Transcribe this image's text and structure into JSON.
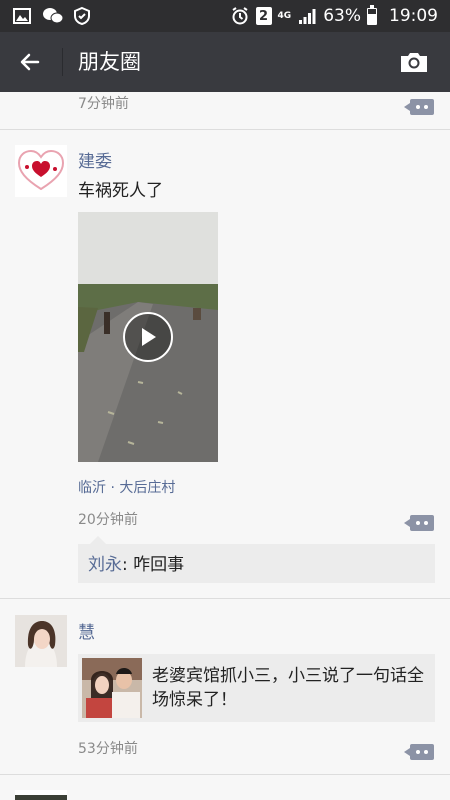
{
  "status_bar": {
    "badge": "2",
    "network": "4G",
    "battery_text": "63%",
    "battery_level": 0.63,
    "time": "19:09",
    "icons": [
      "gallery-icon",
      "wechat-icon",
      "shield-check-icon",
      "alarm-icon",
      "signal-icon",
      "battery-icon"
    ]
  },
  "title_bar": {
    "title": "朋友圈",
    "back_icon": "back-arrow-icon",
    "camera_icon": "camera-icon"
  },
  "feed": {
    "top_partial": {
      "time": "7分钟前"
    },
    "posts": [
      {
        "author": "建委",
        "text": "车祸死人了",
        "media": "video",
        "location": "临沂 · 大后庄村",
        "time": "20分钟前",
        "comment": {
          "author": "刘永",
          "separator": ": ",
          "text": "咋回事"
        }
      },
      {
        "author": "慧",
        "share": {
          "title": "老婆宾馆抓小三，小三说了一句话全场惊呆了！"
        },
        "time": "53分钟前"
      }
    ]
  },
  "colors": {
    "status_bar_bg": "#2e2e30",
    "title_bar_bg": "#393a3f",
    "link_blue": "#576b95",
    "feed_bg": "#f7f7f7"
  }
}
